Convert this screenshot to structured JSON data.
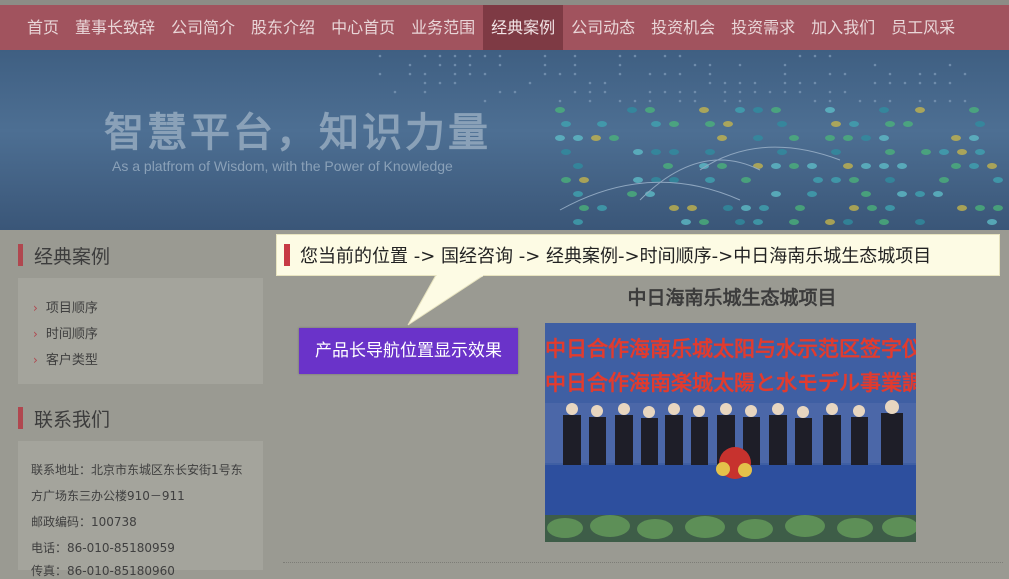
{
  "nav": {
    "items": [
      "首页",
      "董事长致辞",
      "公司简介",
      "股东介绍",
      "中心首页",
      "业务范围",
      "经典案例",
      "公司动态",
      "投资机会",
      "投资需求",
      "加入我们",
      "员工风采"
    ],
    "active": "经典案例"
  },
  "banner": {
    "title": "智慧平台，知识力量",
    "subtitle": "As a platfrom of Wisdom, with the Power of Knowledge"
  },
  "sidebar": {
    "cases": {
      "title": "经典案例",
      "links": [
        "项目顺序",
        "时间顺序",
        "客户类型"
      ]
    },
    "contact": {
      "title": "联系我们",
      "lines": [
        "联系地址：北京市东城区东长安街1号东",
        "方广场东三办公楼910－911",
        "邮政编码：100738",
        "电话：86-010-85180959",
        "传真：86-010-85180960"
      ]
    }
  },
  "breadcrumb": "您当前的位置 -> 国经咨询 -> 经典案例->时间顺序->中日海南乐城生态城项目",
  "tooltip_button": "产品长导航位置显示效果",
  "article": {
    "title": "中日海南乐城生态城项目",
    "photo_line1": "中日合作海南乐城太阳与水示范区签字仪式",
    "photo_line2": "中日合作海南楽城太陽と水モデル事業調印式"
  },
  "colors": {
    "nav_bg": "#a1535e",
    "accent_bar": "#b0474f",
    "tooltip_button_bg": "#6a33c9",
    "breadcrumb_bg": "#fdfbe4"
  }
}
